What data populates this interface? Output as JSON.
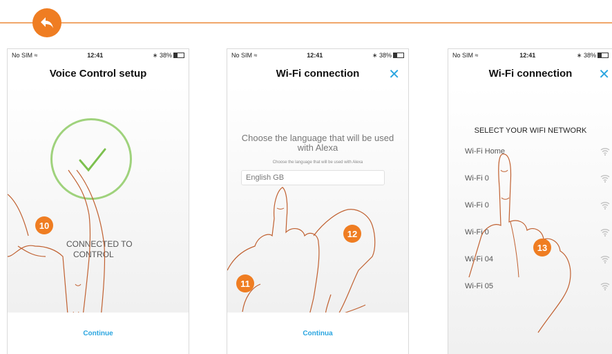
{
  "accent_color": "#ef7d22",
  "link_color": "#2aa5e0",
  "back_button": {
    "icon": "back-arrow-icon"
  },
  "screens": [
    {
      "status": {
        "carrier": "No SIM",
        "time": "12:41",
        "battery": "38%"
      },
      "title": "Voice Control setup",
      "message_line1": "CONNECTED TO",
      "message_line2": "CONTROL",
      "footer_button": "Continue",
      "step": "10"
    },
    {
      "status": {
        "carrier": "No SIM",
        "time": "12:41",
        "battery": "38%"
      },
      "title": "Wi-Fi connection",
      "prompt": "Choose the language that will be used with Alexa",
      "prompt_small": "Choose the language that will be used with Alexa",
      "language_value": "English GB",
      "footer_button": "Continua",
      "steps": [
        "11",
        "12"
      ]
    },
    {
      "status": {
        "carrier": "No SIM",
        "time": "12:41",
        "battery": "38%"
      },
      "title": "Wi-Fi connection",
      "heading": "SELECT YOUR WIFI NETWORK",
      "networks": [
        "Wi-Fi Home",
        "Wi-Fi 0",
        "Wi-Fi 0",
        "Wi-Fi 0",
        "Wi-Fi 04",
        "Wi-Fi 05"
      ],
      "step": "13"
    }
  ]
}
